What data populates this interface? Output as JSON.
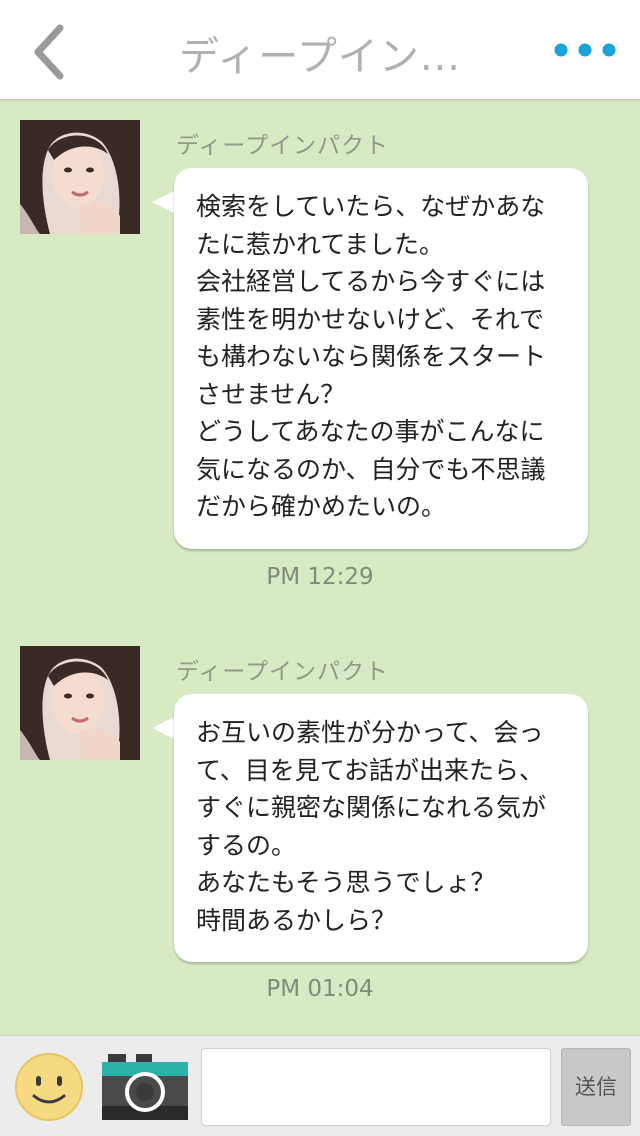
{
  "header": {
    "title": "ディープイン...",
    "back_icon": "chevron-left-icon",
    "more_icon": "more-dots-icon",
    "accent_color": "#1aa3d9"
  },
  "messages": [
    {
      "sender": "ディープインパクト",
      "text": "検索をしていたら、なぜかあなたに惹かれてました。\n会社経営してるから今すぐには素性を明かせないけど、それでも構わないなら関係をスタートさせません？\nどうしてあなたの事がこんなに気になるのか、自分でも不思議だから確かめたいの。",
      "time": "PM 12:29"
    },
    {
      "sender": "ディープインパクト",
      "text": "お互いの素性が分かって、会って、目を見てお話が出来たら、すぐに親密な関係になれる気がするの。\nあなたもそう思うでしょ？\n時間あるかしら？",
      "time": "PM 01:04"
    }
  ],
  "footer": {
    "emoji_icon": "smiley-icon",
    "camera_icon": "camera-icon",
    "input_value": "",
    "send_label": "送信"
  },
  "colors": {
    "background": "#d8eac3",
    "bubble": "#ffffff"
  }
}
